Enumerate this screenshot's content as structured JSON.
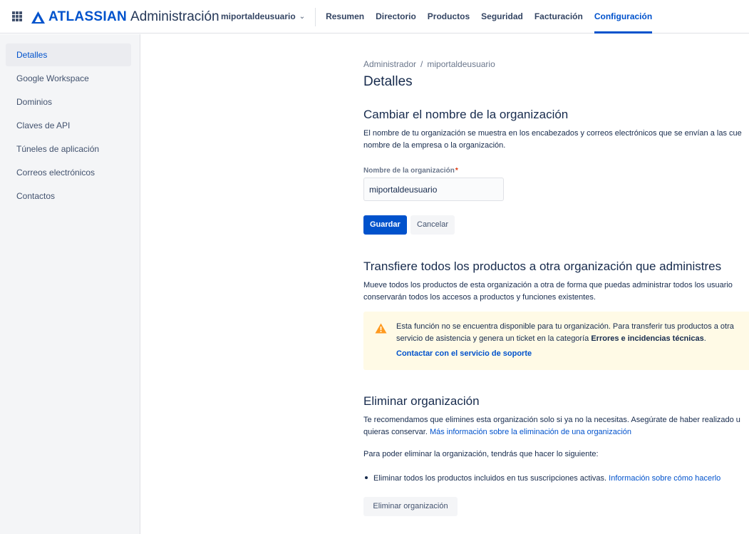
{
  "topbar": {
    "brand_name": "ATLASSIAN",
    "product_name": "Administración",
    "org_switcher": "miportaldeusuario",
    "nav": [
      "Resumen",
      "Directorio",
      "Productos",
      "Seguridad",
      "Facturación",
      "Configuración"
    ],
    "active_nav": "Configuración",
    "brand_color": "#0052cc"
  },
  "sidebar": {
    "items": [
      {
        "label": "Detalles",
        "active": true
      },
      {
        "label": "Google Workspace"
      },
      {
        "label": "Dominios"
      },
      {
        "label": "Claves de API"
      },
      {
        "label": "Túneles de aplicación"
      },
      {
        "label": "Correos electrónicos"
      },
      {
        "label": "Contactos"
      }
    ]
  },
  "main": {
    "breadcrumb": [
      "Administrador",
      "miportaldeusuario"
    ],
    "breadcrumb_separator": "/",
    "title": "Detalles",
    "rename": {
      "heading": "Cambiar el nombre de la organización",
      "desc_line1": "El nombre de tu organización se muestra en los encabezados y correos electrónicos que se envían a las cue",
      "desc_line2": "nombre de la empresa o la organización.",
      "field_label": "Nombre de la organización",
      "required_mark": "*",
      "field_value": "miportaldeusuario",
      "save_label": "Guardar",
      "cancel_label": "Cancelar"
    },
    "transfer": {
      "heading": "Transfiere todos los productos a otra organización que administres",
      "desc_line1": "Mueve todos los productos de esta organización a otra de forma que puedas administrar todos los usuario",
      "desc_line2": "conservarán todos los accesos a productos y funciones existentes.",
      "warning_line1": "Esta función no se encuentra disponible para tu organización. Para transferir tus productos a otra",
      "warning_line2_pre": "servicio de asistencia y genera un ticket en la categoría ",
      "warning_line2_bold": "Errores e incidencias técnicas",
      "warning_line2_post": ".",
      "warning_link": "Contactar con el servicio de soporte",
      "warning_color": "#fffae6"
    },
    "delete": {
      "heading": "Eliminar organización",
      "desc_line1": "Te recomendamos que elimines esta organización solo si ya no la necesitas. Asegúrate de haber realizado u",
      "desc_line2_pre": "quieras conservar. ",
      "desc_line2_link": "Más información sobre la eliminación de una organización",
      "requirement": "Para poder eliminar la organización, tendrás que hacer lo siguiente:",
      "bullet_text": "Eliminar todos los productos incluidos en tus suscripciones activas. ",
      "bullet_link": "Información sobre cómo hacerlo",
      "button_label": "Eliminar organización"
    }
  }
}
